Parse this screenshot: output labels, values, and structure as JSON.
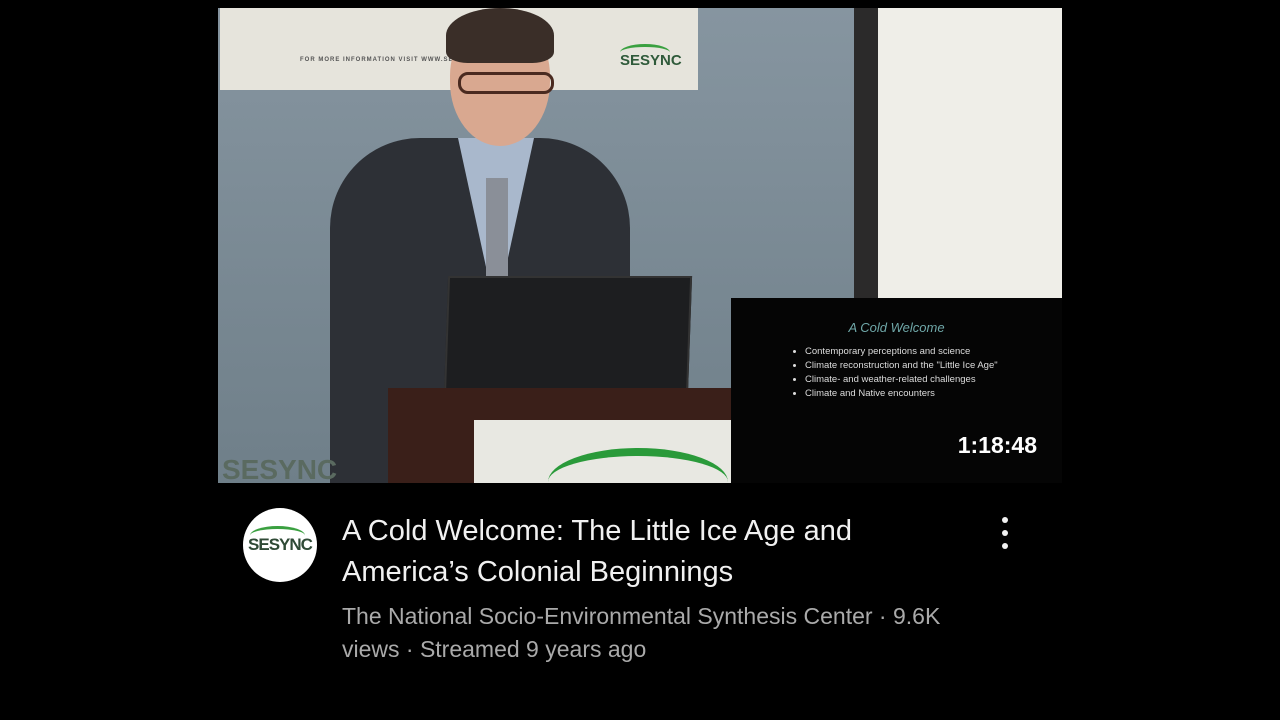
{
  "video": {
    "thumbnail": {
      "banner_text": "FOR MORE INFORMATION VISIT WWW.SES",
      "banner_logo": "SESYNC",
      "wall_logo": "SESYNC",
      "slide": {
        "title": "A Cold Welcome",
        "bullets": [
          "Contemporary perceptions and science",
          "Climate reconstruction and the \"Little Ice Age\"",
          "Climate- and weather-related challenges",
          "Climate and Native encounters"
        ]
      },
      "duration": "1:18:48"
    },
    "channel_avatar_text": "SESYNC",
    "title": "A Cold Welcome: The Little Ice Age and America’s Colonial Beginnings",
    "meta": "The National Socio-Environmental Synthesis Center · 9.6K views · Streamed 9 years ago",
    "menu_icon": "more-vert-icon"
  }
}
